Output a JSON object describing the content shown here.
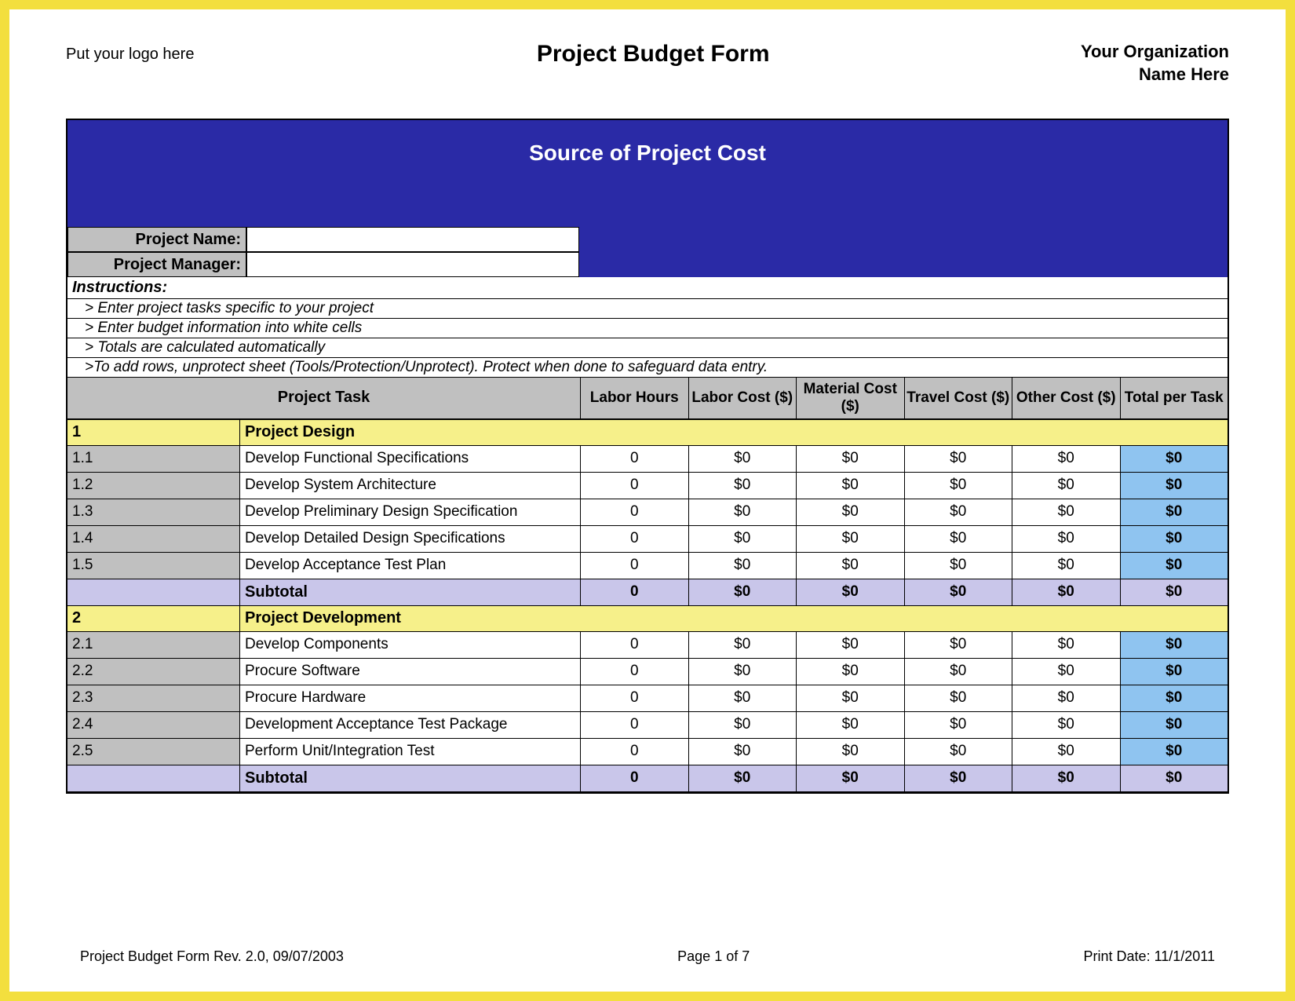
{
  "header": {
    "logo_placeholder": "Put your logo here",
    "title": "Project Budget Form",
    "org_line1": "Your Organization",
    "org_line2": "Name Here"
  },
  "banner": {
    "title": "Source of Project Cost",
    "name_label": "Project Name:",
    "manager_label": "Project Manager:",
    "name_value": "",
    "manager_value": ""
  },
  "instructions": {
    "header": "Instructions:",
    "lines": [
      " > Enter project tasks specific to your project",
      " > Enter budget information into white cells",
      " > Totals are calculated automatically",
      " >To add rows, unprotect sheet (Tools/Protection/Unprotect).  Protect when done to safeguard data entry."
    ]
  },
  "columns": {
    "task": "Project Task",
    "c1": "Labor Hours",
    "c2": "Labor Cost ($)",
    "c3": "Material Cost ($)",
    "c4": "Travel Cost ($)",
    "c5": "Other Cost ($)",
    "c6": "Total per Task"
  },
  "sections": [
    {
      "id": "1",
      "name": "Project Design",
      "rows": [
        {
          "id": "1.1",
          "task": "Develop Functional Specifications",
          "hours": "0",
          "labor": "$0",
          "material": "$0",
          "travel": "$0",
          "other": "$0",
          "total": "$0"
        },
        {
          "id": "1.2",
          "task": "Develop System Architecture",
          "hours": "0",
          "labor": "$0",
          "material": "$0",
          "travel": "$0",
          "other": "$0",
          "total": "$0"
        },
        {
          "id": "1.3",
          "task": "Develop Preliminary Design Specification",
          "hours": "0",
          "labor": "$0",
          "material": "$0",
          "travel": "$0",
          "other": "$0",
          "total": "$0"
        },
        {
          "id": "1.4",
          "task": "Develop Detailed Design Specifications",
          "hours": "0",
          "labor": "$0",
          "material": "$0",
          "travel": "$0",
          "other": "$0",
          "total": "$0"
        },
        {
          "id": "1.5",
          "task": "Develop Acceptance Test Plan",
          "hours": "0",
          "labor": "$0",
          "material": "$0",
          "travel": "$0",
          "other": "$0",
          "total": "$0"
        }
      ],
      "subtotal": {
        "label": "Subtotal",
        "hours": "0",
        "labor": "$0",
        "material": "$0",
        "travel": "$0",
        "other": "$0",
        "total": "$0"
      }
    },
    {
      "id": "2",
      "name": "Project Development",
      "rows": [
        {
          "id": "2.1",
          "task": "Develop Components",
          "hours": "0",
          "labor": "$0",
          "material": "$0",
          "travel": "$0",
          "other": "$0",
          "total": "$0"
        },
        {
          "id": "2.2",
          "task": "Procure Software",
          "hours": "0",
          "labor": "$0",
          "material": "$0",
          "travel": "$0",
          "other": "$0",
          "total": "$0"
        },
        {
          "id": "2.3",
          "task": "Procure Hardware",
          "hours": "0",
          "labor": "$0",
          "material": "$0",
          "travel": "$0",
          "other": "$0",
          "total": "$0"
        },
        {
          "id": "2.4",
          "task": "Development Acceptance Test Package",
          "hours": "0",
          "labor": "$0",
          "material": "$0",
          "travel": "$0",
          "other": "$0",
          "total": "$0"
        },
        {
          "id": "2.5",
          "task": "Perform Unit/Integration Test",
          "hours": "0",
          "labor": "$0",
          "material": "$0",
          "travel": "$0",
          "other": "$0",
          "total": "$0"
        }
      ],
      "subtotal": {
        "label": "Subtotal",
        "hours": "0",
        "labor": "$0",
        "material": "$0",
        "travel": "$0",
        "other": "$0",
        "total": "$0"
      }
    }
  ],
  "footer": {
    "revision": "Project Budget Form Rev. 2.0, 09/07/2003",
    "page": "Page 1 of 7",
    "print": "Print Date: 11/1/2011"
  }
}
